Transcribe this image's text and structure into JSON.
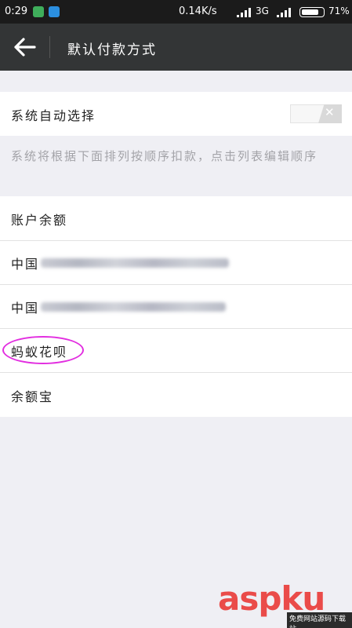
{
  "status_bar": {
    "time": "0:29",
    "speed": "0.14K/s",
    "network": "3G",
    "battery": "71%"
  },
  "toolbar": {
    "back_icon": "back-arrow-icon",
    "title": "默认付款方式"
  },
  "auto_select": {
    "label": "系统自动选择",
    "toggle_state": "off"
  },
  "hint": "系统将根据下面排列按顺序扣款，点击列表编辑顺序",
  "payment_methods": [
    {
      "label": "账户余额"
    },
    {
      "label": "中国"
    },
    {
      "label": "中国"
    },
    {
      "label": "蚂蚁花呗"
    },
    {
      "label": "余额宝"
    }
  ],
  "watermark": {
    "text": "aspku",
    "sub": "免费网站源码下载站"
  },
  "colors": {
    "toolbar": "#333536",
    "status_bar": "#1b1b1b",
    "highlight_circle": "#e22ee0",
    "watermark": "#ea4b49"
  }
}
